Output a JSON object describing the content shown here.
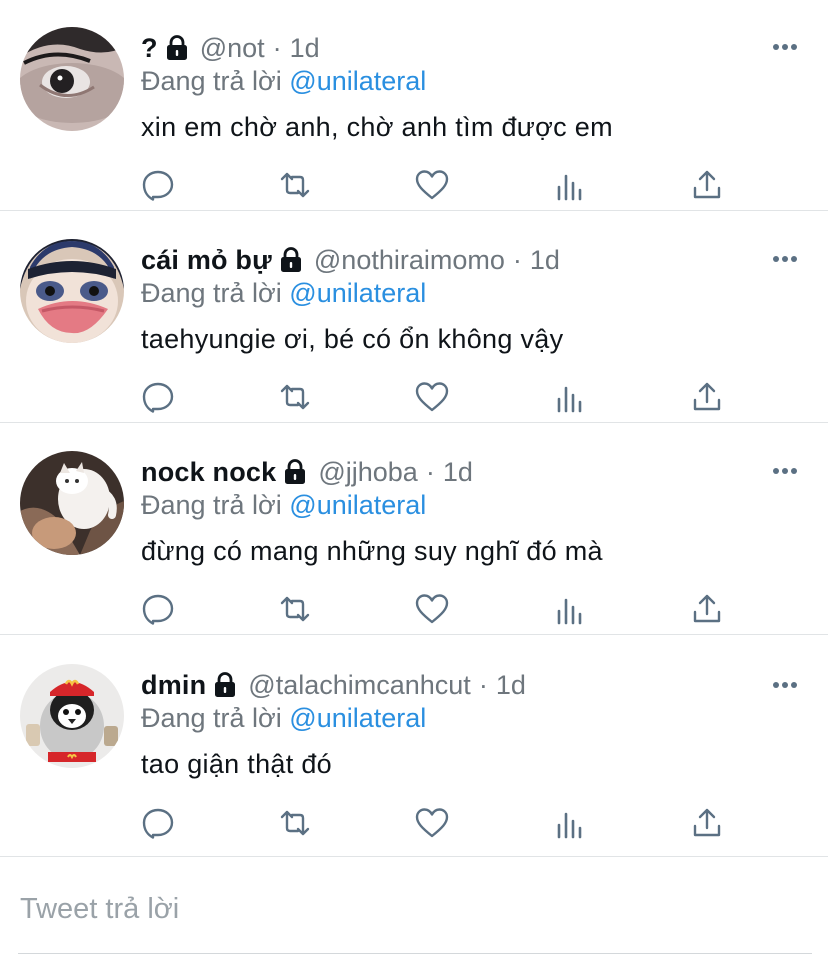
{
  "tweets": [
    {
      "name": "?",
      "handle": "@not",
      "dot": "·",
      "time": "1d",
      "reply_prefix": "Đang trả lời",
      "reply_to": "@unilateral",
      "text": "xin em chờ anh, chờ anh tìm được em"
    },
    {
      "name": "cái mỏ bự",
      "handle": "@nothiraimomo",
      "dot": "·",
      "time": "1d",
      "reply_prefix": "Đang trả lời",
      "reply_to": "@unilateral",
      "text": "taehyungie ơi, bé có ổn không vậy"
    },
    {
      "name": "nock nock",
      "handle": "@jjhoba",
      "dot": "·",
      "time": "1d",
      "reply_prefix": "Đang trả lời",
      "reply_to": "@unilateral",
      "text": "đừng có mang những suy nghĩ đó mà"
    },
    {
      "name": "dmin",
      "handle": "@talachimcanhcut",
      "dot": "·",
      "time": "1d",
      "reply_prefix": "Đang trả lời",
      "reply_to": "@unilateral",
      "text": "tao giận thật đó"
    }
  ],
  "icons": {
    "lock": "lock-icon",
    "more": "more-icon",
    "reply": "reply-icon",
    "retweet": "retweet-icon",
    "like": "heart-icon",
    "analytics": "analytics-icon",
    "share": "share-icon"
  },
  "colors": {
    "mention": "#2a8fe0",
    "secondary_text": "#6e767d",
    "icon": "#5b7083",
    "divider": "#e1e4e6"
  },
  "composer": {
    "placeholder": "Tweet trả lời"
  }
}
